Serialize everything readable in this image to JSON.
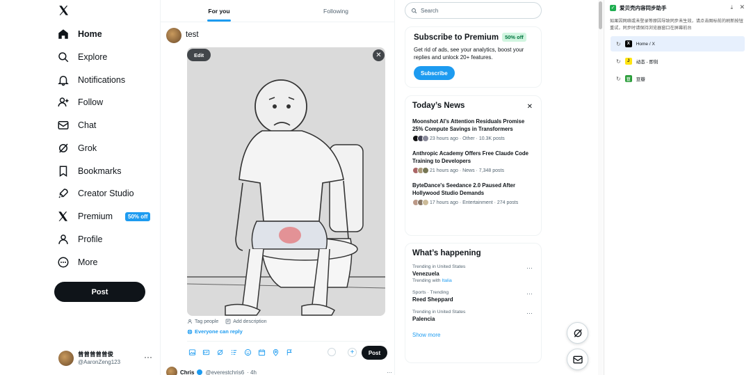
{
  "nav": {
    "items": [
      {
        "label": "Home"
      },
      {
        "label": "Explore"
      },
      {
        "label": "Notifications"
      },
      {
        "label": "Follow"
      },
      {
        "label": "Chat"
      },
      {
        "label": "Grok"
      },
      {
        "label": "Bookmarks"
      },
      {
        "label": "Creator Studio"
      },
      {
        "label": "Premium",
        "badge": "50% off"
      },
      {
        "label": "Profile"
      },
      {
        "label": "More"
      }
    ],
    "post_label": "Post"
  },
  "account": {
    "name": "曾曾曾曾曾俊",
    "handle": "@AaronZeng123",
    "more": "···"
  },
  "feed": {
    "tabs": [
      "For you",
      "Following"
    ],
    "composer_text": "test",
    "edit_label": "Edit",
    "close_label": "✕",
    "tag_people": "Tag people",
    "add_description": "Add description",
    "reply_setting": "Everyone can reply",
    "post_label": "Post",
    "next_tweet": {
      "name": "Chris",
      "handle": "@everestchris6",
      "time": "· 4h",
      "more": "···"
    }
  },
  "right": {
    "search_placeholder": "Search",
    "premium": {
      "title": "Subscribe to Premium",
      "badge": "50% off",
      "desc": "Get rid of ads, see your analytics, boost your replies and unlock 20+ features.",
      "button": "Subscribe"
    },
    "news": {
      "title": "Today’s News",
      "close": "✕",
      "items": [
        {
          "headline": "Moonshot AI’s Attention Residuals Promise 25% Compute Savings in Transformers",
          "meta": "23 hours ago · Other · 10.3K posts"
        },
        {
          "headline": "Anthropic Academy Offers Free Claude Code Training to Developers",
          "meta": "21 hours ago · News · 7,348 posts"
        },
        {
          "headline": "ByteDance's Seedance 2.0 Paused After Hollywood Studio Demands",
          "meta": "17 hours ago · Entertainment · 274 posts"
        }
      ]
    },
    "happening": {
      "title": "What’s happening",
      "trends": [
        {
          "context": "Trending in United States",
          "name": "Venezuela",
          "sub_prefix": "Trending with",
          "sub_link": "Italia"
        },
        {
          "context": "Sports · Trending",
          "name": "Reed Sheppard",
          "sub_prefix": "",
          "sub_link": ""
        },
        {
          "context": "Trending in United States",
          "name": "Palencia",
          "sub_prefix": "",
          "sub_link": ""
        }
      ],
      "more": "···",
      "show_more": "Show more"
    }
  },
  "panel": {
    "title": "爱贝壳内容同步助手",
    "desc": "如果因网络或未登录等原因导致同步未生效，请点击图标前的刷新按钮重试，同步时请保持浏览器窗口在屏幕前台",
    "items": [
      {
        "label": "Home / X",
        "icon": "x-favicon",
        "fav": "X"
      },
      {
        "label": "动态 - 即刻",
        "icon": "jike-favicon",
        "fav": "J"
      },
      {
        "label": "豆瓣",
        "icon": "douban-favicon",
        "fav": "豆"
      }
    ]
  },
  "colors": {
    "accent": "#1d9bf0",
    "dark": "#0f1419",
    "muted": "#536471",
    "success": "#1fae51"
  }
}
